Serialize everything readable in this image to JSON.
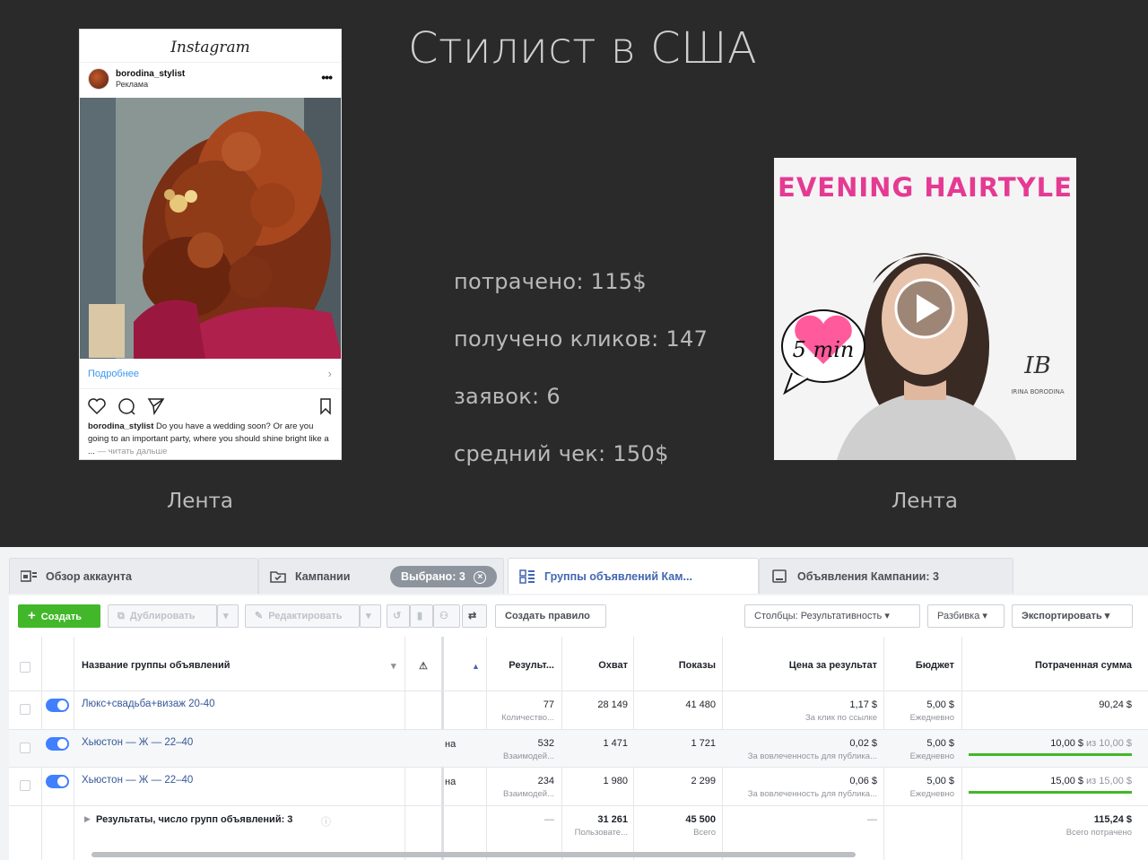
{
  "slide": {
    "title": "Стилист в США",
    "stats": [
      "потрачено: 115$",
      "получено кликов: 147",
      "заявок: 6",
      "средний чек: 150$"
    ],
    "left_caption": "Лента",
    "right_caption": "Лента"
  },
  "instagram": {
    "logo": "Instagram",
    "username": "borodina_stylist",
    "sponsored": "Реклама",
    "more_link": "Подробнее",
    "caption_user": "borodina_stylist",
    "caption_text": " Do you have a wedding soon? Or are you going to an important party, where you should shine bright like a ...",
    "caption_more": " — читать дальше"
  },
  "video": {
    "title": "EVENING HAIRTYLE",
    "badge": "5 min",
    "monogram": "IB",
    "brand": "IRINA BORODINA"
  },
  "ads_manager": {
    "tabs": [
      {
        "label": "Обзор аккаунта"
      },
      {
        "label": "Кампании"
      },
      {
        "label": "Группы объявлений Кам..."
      },
      {
        "label": "Объявления Кампании: 3"
      }
    ],
    "selected_pill": "Выбрано: 3",
    "toolbar": {
      "create": "Создать",
      "duplicate": "Дублировать",
      "edit": "Редактировать",
      "create_rule": "Создать правило",
      "columns": "Столбцы: Результативность",
      "breakdown": "Разбивка",
      "export": "Экспортировать"
    },
    "headers": {
      "name": "Название группы объявлений",
      "results": "Результ...",
      "reach": "Охват",
      "impressions": "Показы",
      "cost_per_result": "Цена за результат",
      "budget": "Бюджет",
      "spent": "Потраченная сумма"
    },
    "rows": [
      {
        "name": "Люкс+свадьба+визаж 20-40",
        "clip": "",
        "results": "77",
        "results_sub": "Количество...",
        "reach": "28 149",
        "impressions": "41 480",
        "cost": "1,17 $",
        "cost_sub": "За клик по ссылке",
        "budget": "5,00 $",
        "budget_sub": "Ежедневно",
        "spent": "90,24 $",
        "spent_of": "",
        "progress": 0
      },
      {
        "name": "Хьюстон — Ж — 22–40",
        "clip": "на",
        "results": "532",
        "results_sub": "Взаимодей...",
        "reach": "1 471",
        "impressions": "1 721",
        "cost": "0,02 $",
        "cost_sub": "За вовлеченность для публика...",
        "budget": "5,00 $",
        "budget_sub": "Ежедневно",
        "spent": "10,00 $",
        "spent_of": " из 10,00 $",
        "progress": 1
      },
      {
        "name": "Хьюстон — Ж — 22–40",
        "clip": "на",
        "results": "234",
        "results_sub": "Взаимодей...",
        "reach": "1 980",
        "impressions": "2 299",
        "cost": "0,06 $",
        "cost_sub": "За вовлеченность для публика...",
        "budget": "5,00 $",
        "budget_sub": "Ежедневно",
        "spent": "15,00 $",
        "spent_of": " из 15,00 $",
        "progress": 1
      }
    ],
    "totals": {
      "label": "Результаты, число групп объявлений: 3",
      "results": "—",
      "reach": "31 261",
      "reach_sub": "Пользовате...",
      "impressions": "45 500",
      "impressions_sub": "Всего",
      "cost": "—",
      "spent": "115,24 $",
      "spent_sub": "Всего потрачено"
    }
  }
}
